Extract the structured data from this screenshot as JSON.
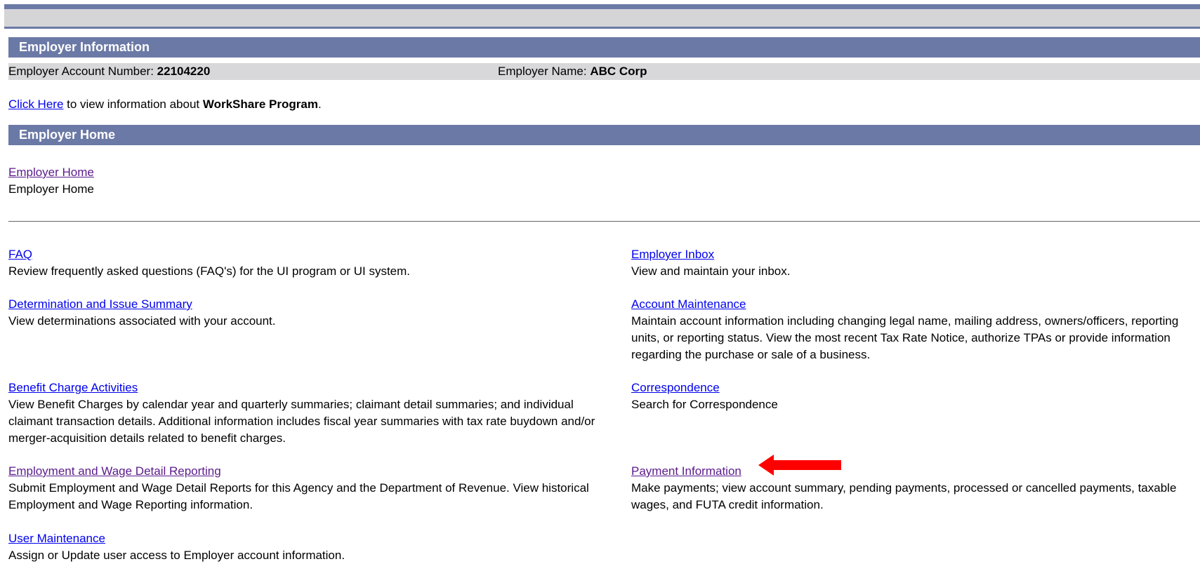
{
  "employer_info": {
    "header": "Employer Information",
    "account_label": "Employer Account Number: ",
    "account_value": "22104220",
    "name_label": "Employer Name: ",
    "name_value": "ABC Corp"
  },
  "workshare": {
    "link": "Click Here",
    "text_before_bold": " to view information about ",
    "bold": "WorkShare Program",
    "text_after": "."
  },
  "employer_home": {
    "header": "Employer Home",
    "link": "Employer Home",
    "subtitle": "Employer Home"
  },
  "left_items": [
    {
      "title": "FAQ",
      "desc": "Review frequently asked questions (FAQ's) for the UI program or UI system."
    },
    {
      "title": "Determination and Issue Summary",
      "desc": "View determinations associated with your account."
    },
    {
      "title": "Benefit Charge Activities",
      "desc": "View Benefit Charges by calendar year and quarterly summaries; claimant detail summaries; and individual claimant transaction details. Additional information includes fiscal year summaries with tax rate buydown and/or merger-acquisition details related to benefit charges."
    },
    {
      "title": "Employment and Wage Detail Reporting",
      "desc": "Submit Employment and Wage Detail Reports for this Agency and the Department of Revenue. View historical Employment and Wage Reporting information."
    },
    {
      "title": "User Maintenance",
      "desc": "Assign or Update user access to Employer account information."
    }
  ],
  "right_items": [
    {
      "title": "Employer Inbox",
      "desc": "View and maintain your inbox."
    },
    {
      "title": "Account Maintenance",
      "desc": "Maintain account information including changing legal name, mailing address, owners/officers, reporting units, or reporting status. View the most recent Tax Rate Notice, authorize TPAs or provide information regarding the purchase or sale of a business."
    },
    {
      "title": "Correspondence",
      "desc": "Search for Correspondence"
    },
    {
      "title": "Payment Information",
      "desc": "Make payments; view account summary, pending payments, processed or cancelled payments, taxable wages, and FUTA credit information."
    }
  ],
  "colors": {
    "header_bg": "#6b79a6",
    "info_row_bg": "#d8d8da",
    "link": "#0000ee",
    "visited_link": "#5a1a8b",
    "arrow": "#ff0000"
  }
}
